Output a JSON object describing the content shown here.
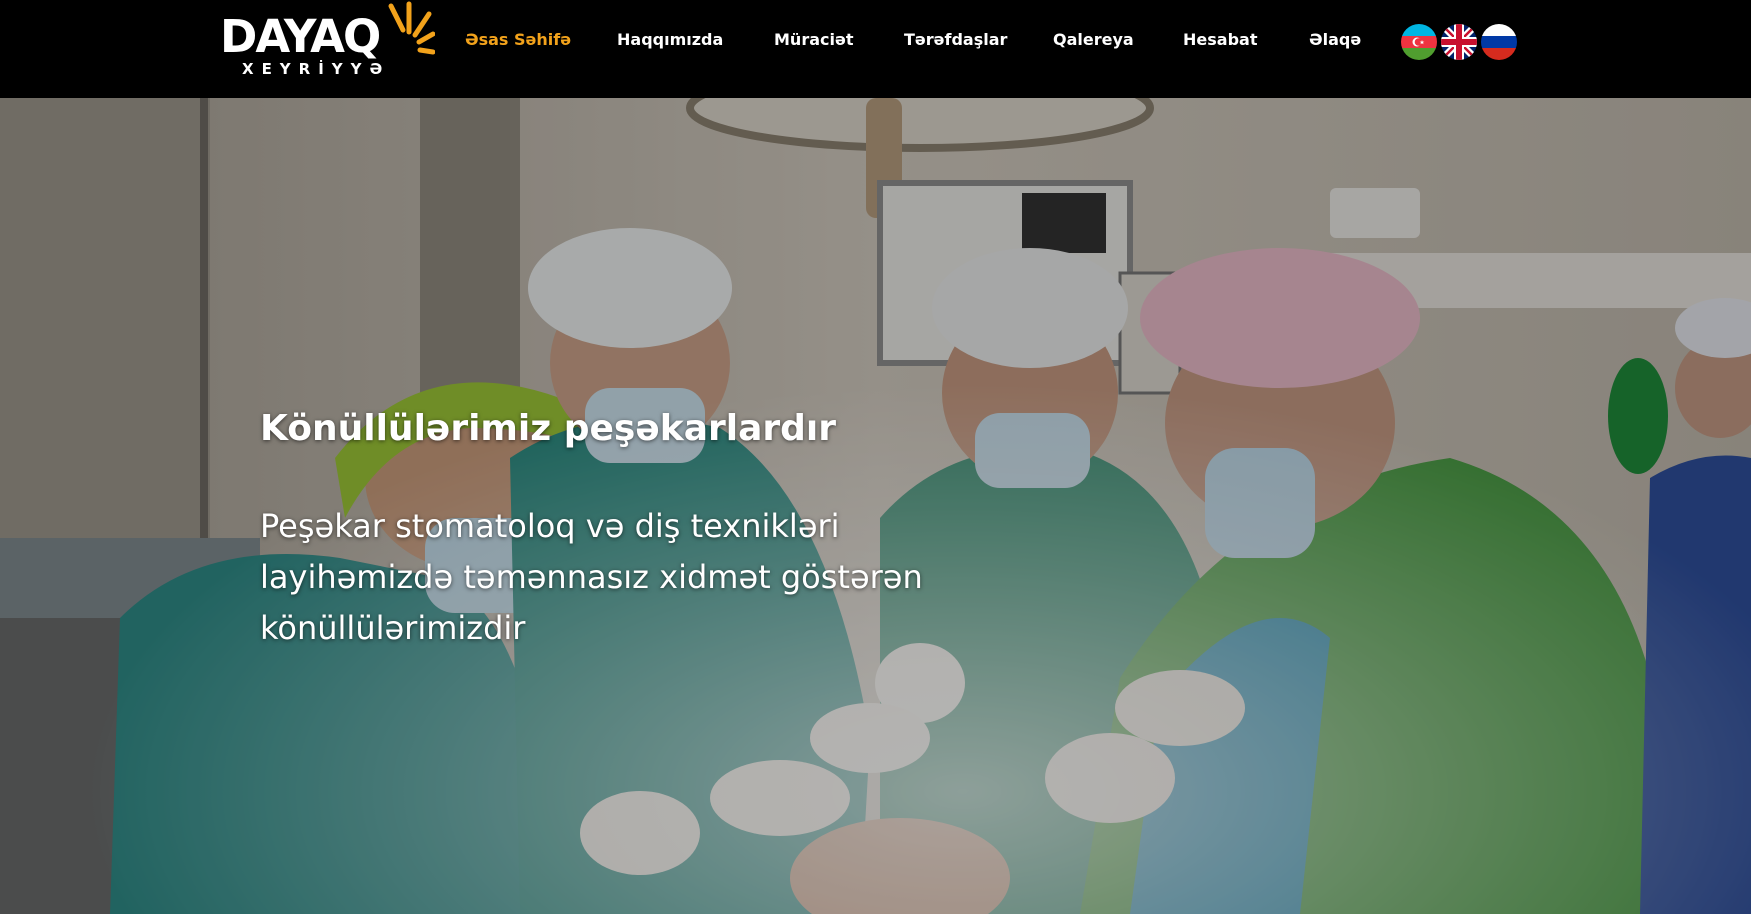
{
  "header": {
    "logo": {
      "name": "DAYAQ",
      "subtitle": "XEYRİYYƏ"
    },
    "nav": [
      {
        "label": "Əsas Səhifə",
        "active": true
      },
      {
        "label": "Haqqımızda",
        "active": false
      },
      {
        "label": "Müraciət",
        "active": false
      },
      {
        "label": "Tərəfdaşlar",
        "active": false
      },
      {
        "label": "Qalereya",
        "active": false
      },
      {
        "label": "Hesabat",
        "active": false
      },
      {
        "label": "Əlaqə",
        "active": false
      }
    ],
    "languages": [
      {
        "icon": "azerbaijan-flag-icon"
      },
      {
        "icon": "uk-flag-icon"
      },
      {
        "icon": "russia-flag-icon"
      }
    ]
  },
  "hero": {
    "title": "Könüllülərimiz peşəkarlardır",
    "description": "Peşəkar stomatoloq və diş texnikləri layihəmizdə təmənnasız xidmət göstərən könüllülərimizdir",
    "background_icon": "surgery-team-photo"
  },
  "colors": {
    "accent": "#f2a21b",
    "header_bg": "#000000",
    "text": "#ffffff"
  }
}
